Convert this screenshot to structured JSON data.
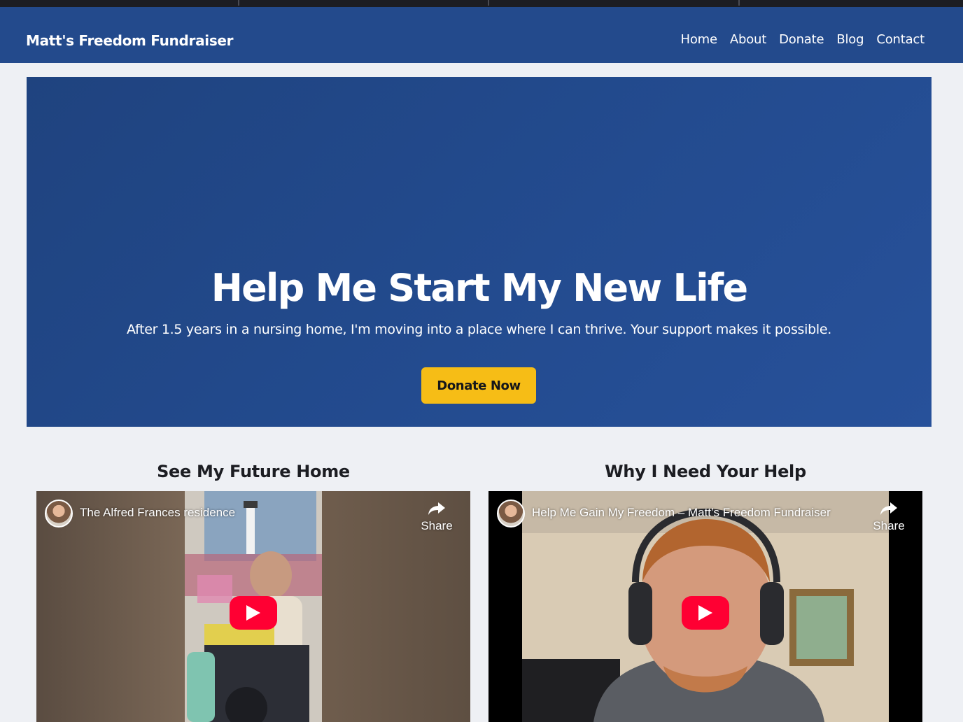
{
  "site": {
    "brand": "Matt's Freedom Fundraiser",
    "nav": [
      "Home",
      "About",
      "Donate",
      "Blog",
      "Contact"
    ]
  },
  "hero": {
    "title": "Help Me Start My New Life",
    "subtitle": "After 1.5 years in a nursing home, I'm moving into a place where I can thrive. Your support makes it possible.",
    "cta": "Donate Now"
  },
  "videos": [
    {
      "section_title": "See My Future Home",
      "video_title": "The Alfred Frances residence",
      "share_label": "Share"
    },
    {
      "section_title": "Why I Need Your Help",
      "video_title": "Help Me Gain My Freedom – Matt’s Freedom Fundraiser",
      "share_label": "Share"
    }
  ],
  "colors": {
    "navbar": "#234a8c",
    "hero": "#234b8f",
    "cta": "#f6bd16",
    "play_button": "#ff0033"
  },
  "icons": [
    "share-arrow-icon",
    "youtube-play-icon",
    "channel-avatar"
  ]
}
